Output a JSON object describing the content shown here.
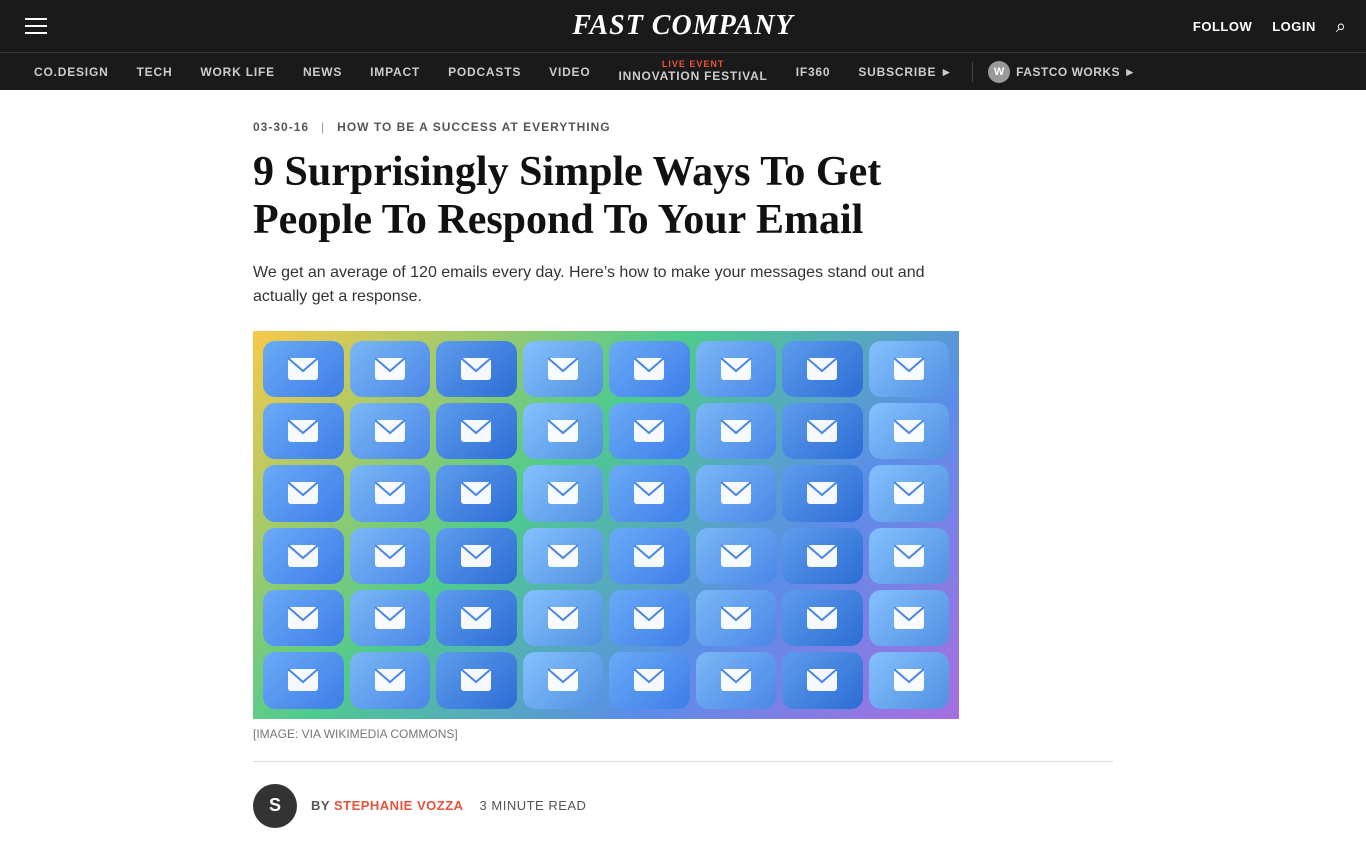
{
  "header": {
    "hamburger_label": "Menu",
    "logo": "FAST COMPANY",
    "logo_fast": "FAST",
    "logo_company": "CΟMPANY",
    "follow_label": "FOLLOW",
    "login_label": "LOGIN",
    "search_label": "Search"
  },
  "nav": {
    "items": [
      {
        "id": "co-design",
        "label": "CO.DESIGN"
      },
      {
        "id": "tech",
        "label": "TECH"
      },
      {
        "id": "work-life",
        "label": "WORK LIFE"
      },
      {
        "id": "news",
        "label": "NEWS"
      },
      {
        "id": "impact",
        "label": "IMPACT"
      },
      {
        "id": "podcasts",
        "label": "PODCASTS"
      },
      {
        "id": "video",
        "label": "VIDEO"
      }
    ],
    "innovation_live_label": "LIVE EVENT",
    "innovation_label": "INNOVATION FESTIVAL",
    "if360_label": "IF360",
    "subscribe_label": "SUBSCRIBE ►",
    "fastco_works_badge": "W",
    "fastco_works_label": "FASTCO WORKS ►"
  },
  "article": {
    "date": "03-30-16",
    "meta_divider": "|",
    "category": "HOW TO BE A SUCCESS AT EVERYTHING",
    "title": "9 Surprisingly Simple Ways To Get People To Respond To Your Email",
    "subtitle": "We get an average of 120 emails every day. Here’s how to make your messages stand out and actually get a response.",
    "image_caption": "[IMAGE: VIA WIKIMEDIA COMMONS]",
    "author_byline": "BY",
    "author_name": "STEPHANIE VOZZA",
    "read_time": "3 MINUTE READ",
    "author_initial": "S"
  }
}
